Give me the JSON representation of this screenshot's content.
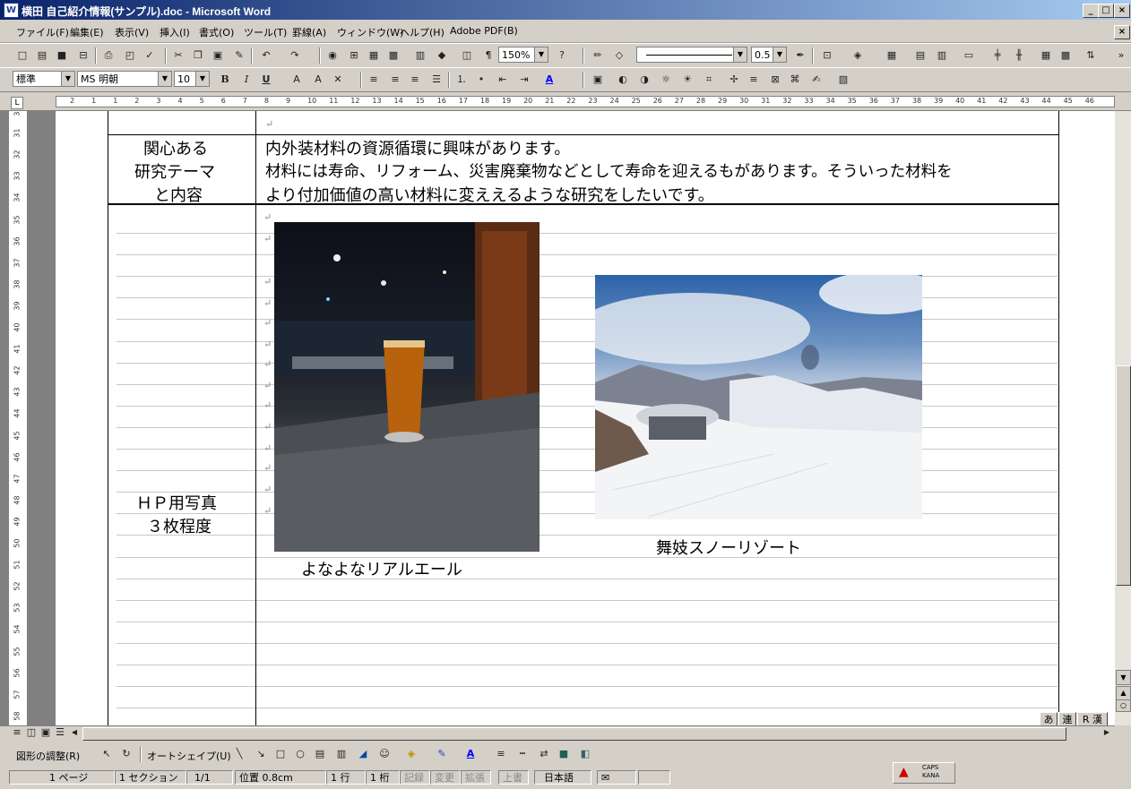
{
  "window": {
    "title": "横田 自己紹介情報(サンプル).doc - Microsoft Word",
    "min": "_",
    "max": "□",
    "close": "×"
  },
  "menu": [
    "ファイル(F)",
    "編集(E)",
    "表示(V)",
    "挿入(I)",
    "書式(O)",
    "ツール(T)",
    "罫線(A)",
    "ウィンドウ(W)",
    "ヘルプ(H)",
    "Adobe PDF(B)"
  ],
  "toolbar": {
    "zoom": "150%",
    "line_width": "0.5"
  },
  "format": {
    "style": "標準",
    "font": "MS 明朝",
    "size": "10"
  },
  "ruler": {
    "numbers": [
      "2",
      "1",
      "1",
      "2",
      "3",
      "4",
      "5",
      "6",
      "7",
      "8",
      "9",
      "10",
      "11",
      "12",
      "13",
      "14",
      "15",
      "16",
      "17",
      "18",
      "19",
      "20",
      "21",
      "22",
      "23",
      "24",
      "25",
      "26",
      "27",
      "28",
      "29",
      "30",
      "31",
      "32",
      "33",
      "34",
      "35",
      "36",
      "37",
      "38",
      "39",
      "40",
      "41",
      "42",
      "43",
      "44",
      "45",
      "46"
    ]
  },
  "vruler": {
    "numbers": [
      "30",
      "31",
      "32",
      "33",
      "34",
      "35",
      "36",
      "37",
      "38",
      "39",
      "40",
      "41",
      "42",
      "43",
      "44",
      "45",
      "46",
      "47",
      "48",
      "49",
      "50",
      "51",
      "52",
      "53",
      "54",
      "55",
      "56",
      "57",
      "58"
    ]
  },
  "doc": {
    "row1_label": [
      "関心ある",
      "研究テーマ",
      "と内容"
    ],
    "row1_lines": [
      "内外装材料の資源循環に興味があります。",
      "材料には寿命、リフォーム、災害廃棄物などとして寿命を迎えるもがあります。そういった材料を",
      "より付加価値の高い材料に変ええるような研究をしたいです。"
    ],
    "row2_label": [
      "ＨＰ用写真",
      "３枚程度"
    ],
    "caption1": "よなよなリアルエール",
    "caption2": "舞妓スノーリゾート",
    "para_mark": "↵"
  },
  "drawing": {
    "adjust": "図形の調整(R)",
    "autoshape": "オートシェイプ(U)"
  },
  "status": {
    "page": "1 ページ",
    "section": "1 セクション",
    "pages": "1/1",
    "position": "位置 0.8cm",
    "line": "1 行",
    "col": "1 桁",
    "rec": "記録",
    "trk": "変更",
    "ext": "拡張",
    "ovr": "上書",
    "lang": "日本語",
    "caps": "CAPS",
    "kana": "KANA"
  },
  "ime": [
    "あ",
    "連",
    "R 漢"
  ]
}
